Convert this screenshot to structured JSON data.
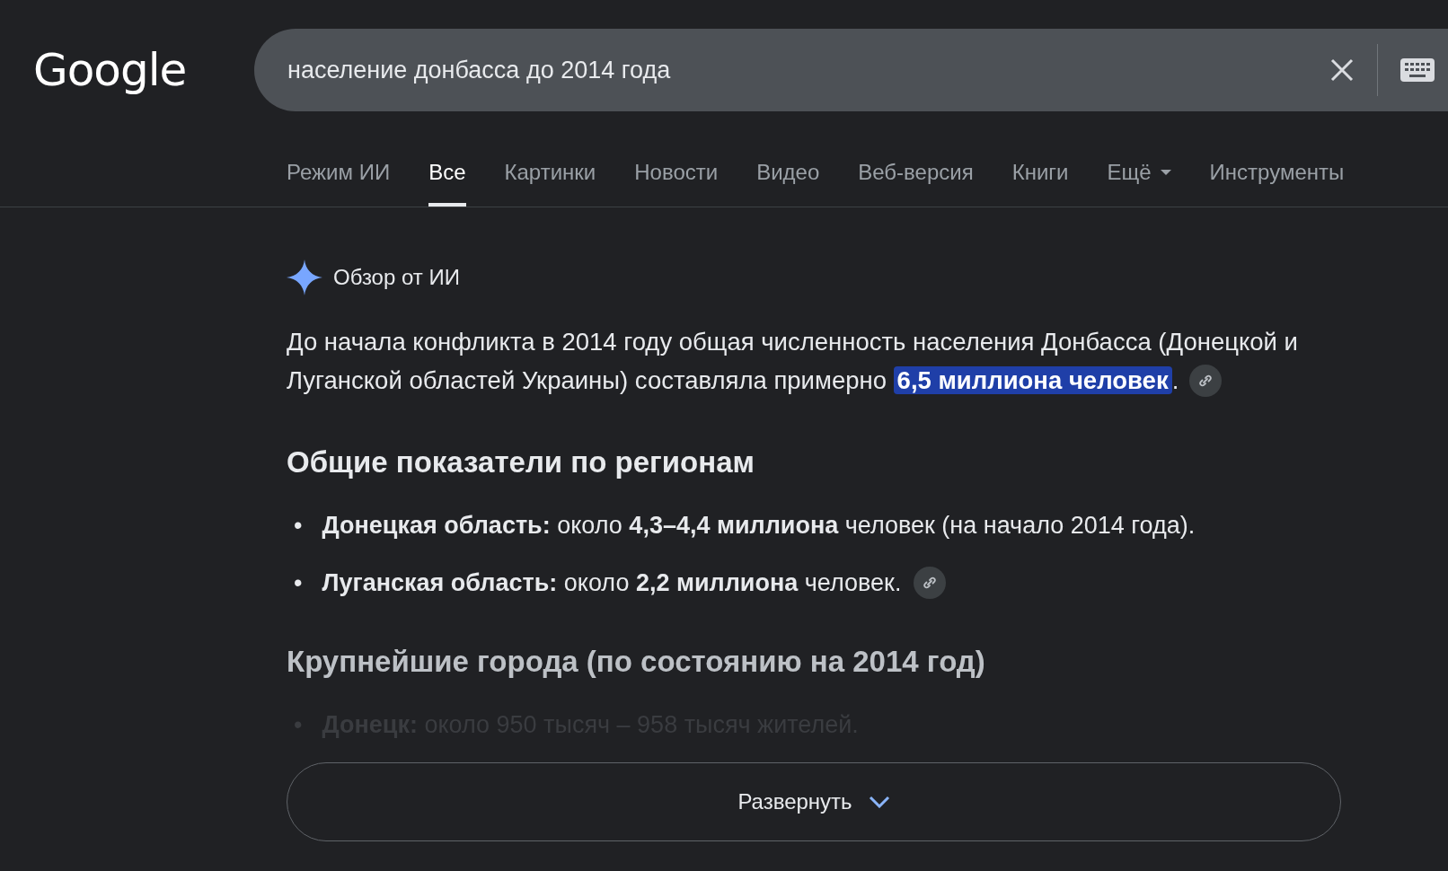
{
  "logo": "Google",
  "search": {
    "value": "население донбасса до 2014 года"
  },
  "tabs": [
    {
      "label": "Режим ИИ",
      "selected": false
    },
    {
      "label": "Все",
      "selected": true
    },
    {
      "label": "Картинки",
      "selected": false
    },
    {
      "label": "Новости",
      "selected": false
    },
    {
      "label": "Видео",
      "selected": false
    },
    {
      "label": "Веб-версия",
      "selected": false
    },
    {
      "label": "Книги",
      "selected": false
    },
    {
      "label": "Ещё",
      "selected": false,
      "kind": "menu"
    }
  ],
  "tools": "Инструменты",
  "overview": {
    "title": "Обзор от ИИ",
    "intro": {
      "text": "До начала конфликта в 2014 году общая численность населения Донбасса (Донецкой и Луганской областей Украины) составляла примерно ",
      "highlight": "6,5 миллиона человек",
      "after": "."
    },
    "heading": "Общие показатели по регионам",
    "bullets": [
      {
        "marker": "•",
        "text": "**Донецкая область:** около **4,3–4,4 миллиона** человек (на начало 2014 года).",
        "link": false
      },
      {
        "marker": "•",
        "text": "**Луганская область:** около **2,2 миллиона** человек.",
        "link": true
      }
    ],
    "heading2": "Крупнейшие города (по состоянию на 2014 год)",
    "faded_bullet": {
      "marker": "•",
      "text": "**Донецк:** около 950 тысяч – 958 тысяч жителей."
    },
    "expand": "Развернуть"
  }
}
